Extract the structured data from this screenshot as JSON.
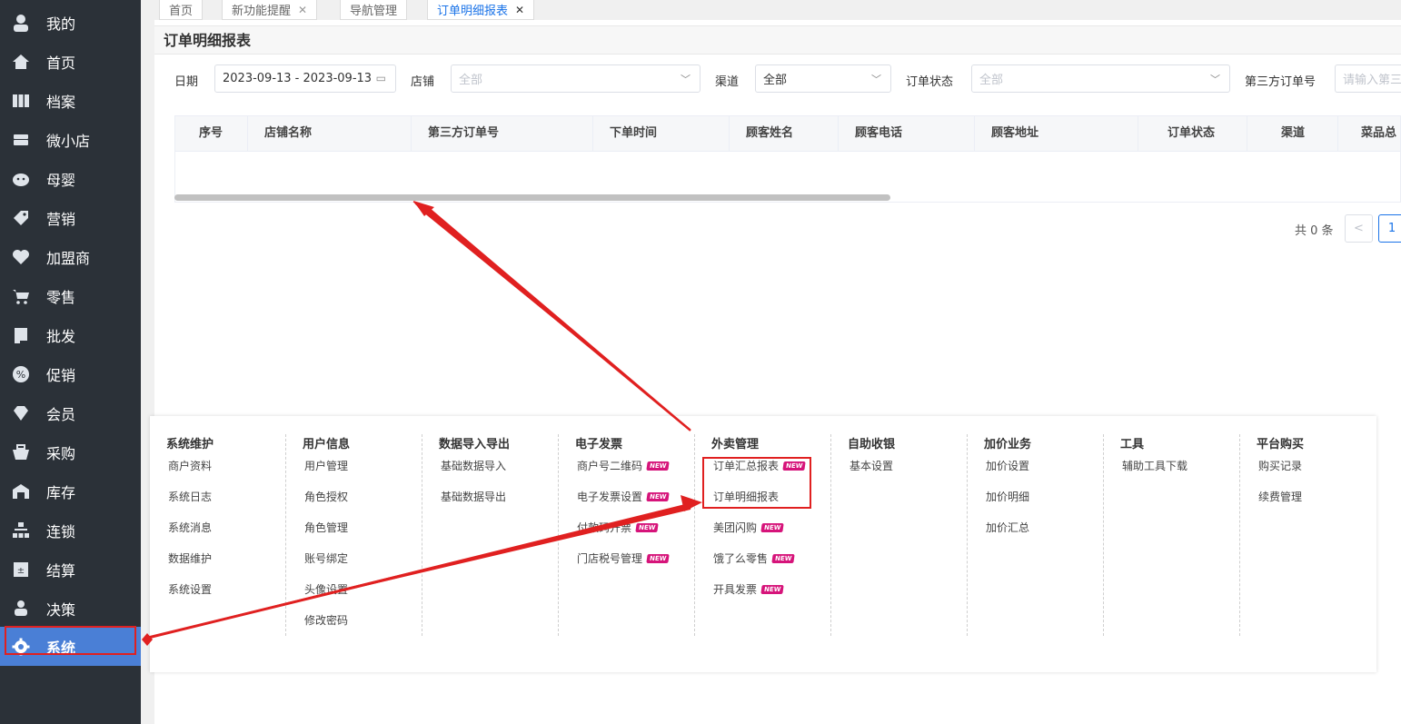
{
  "sidebar": {
    "items": [
      {
        "label": "我的",
        "icon": "user-icon"
      },
      {
        "label": "首页",
        "icon": "home-icon"
      },
      {
        "label": "档案",
        "icon": "grid-icon"
      },
      {
        "label": "微小店",
        "icon": "store-icon"
      },
      {
        "label": "母婴",
        "icon": "baby-icon"
      },
      {
        "label": "营销",
        "icon": "tag-icon"
      },
      {
        "label": "加盟商",
        "icon": "handshake-icon"
      },
      {
        "label": "零售",
        "icon": "cart-icon"
      },
      {
        "label": "批发",
        "icon": "book-icon"
      },
      {
        "label": "促销",
        "icon": "percent-icon"
      },
      {
        "label": "会员",
        "icon": "diamond-icon"
      },
      {
        "label": "采购",
        "icon": "basket-icon"
      },
      {
        "label": "库存",
        "icon": "warehouse-icon"
      },
      {
        "label": "连锁",
        "icon": "sitemap-icon"
      },
      {
        "label": "结算",
        "icon": "calculator-icon"
      },
      {
        "label": "决策",
        "icon": "person-icon"
      },
      {
        "label": "系统",
        "icon": "gear-icon"
      }
    ]
  },
  "tabs": [
    {
      "label": "首页",
      "closable": false
    },
    {
      "label": "新功能提醒",
      "closable": true
    },
    {
      "label": "导航管理",
      "closable": false
    },
    {
      "label": "订单明细报表",
      "closable": true
    }
  ],
  "page": {
    "title": "订单明细报表"
  },
  "filters": {
    "date_label": "日期",
    "date_value": "2023-09-13 - 2023-09-13",
    "store_label": "店铺",
    "store_value": "全部",
    "channel_label": "渠道",
    "channel_value": "全部",
    "status_label": "订单状态",
    "status_value": "全部",
    "third_label": "第三方订单号",
    "third_placeholder": "请输入第三"
  },
  "table": {
    "columns": [
      "序号",
      "店铺名称",
      "第三方订单号",
      "下单时间",
      "顾客姓名",
      "顾客电话",
      "顾客地址",
      "订单状态",
      "渠道",
      "菜品总"
    ]
  },
  "pager": {
    "total": "共 0 条",
    "prev": "<",
    "current": "1"
  },
  "menu": {
    "columns": [
      {
        "title": "系统维护",
        "items": [
          {
            "label": "商户资料"
          },
          {
            "label": "系统日志"
          },
          {
            "label": "系统消息"
          },
          {
            "label": "数据维护"
          },
          {
            "label": "系统设置"
          }
        ]
      },
      {
        "title": "用户信息",
        "items": [
          {
            "label": "用户管理"
          },
          {
            "label": "角色授权"
          },
          {
            "label": "角色管理"
          },
          {
            "label": "账号绑定"
          },
          {
            "label": "头像设置"
          },
          {
            "label": "修改密码"
          }
        ]
      },
      {
        "title": "数据导入导出",
        "items": [
          {
            "label": "基础数据导入"
          },
          {
            "label": "基础数据导出"
          }
        ]
      },
      {
        "title": "电子发票",
        "items": [
          {
            "label": "商户号二维码",
            "new": true
          },
          {
            "label": "电子发票设置",
            "new": true
          },
          {
            "label": "付款码开票",
            "new": true
          },
          {
            "label": "门店税号管理",
            "new": true
          }
        ]
      },
      {
        "title": "外卖管理",
        "items": [
          {
            "label": "订单汇总报表",
            "new": true
          },
          {
            "label": "订单明细报表"
          },
          {
            "label": "美团闪购",
            "new": true
          },
          {
            "label": "饿了么零售",
            "new": true
          },
          {
            "label": "开具发票",
            "new": true
          }
        ]
      },
      {
        "title": "自助收银",
        "items": [
          {
            "label": "基本设置"
          }
        ]
      },
      {
        "title": "加价业务",
        "items": [
          {
            "label": "加价设置"
          },
          {
            "label": "加价明细"
          },
          {
            "label": "加价汇总"
          }
        ]
      },
      {
        "title": "工具",
        "items": [
          {
            "label": "辅助工具下载"
          }
        ]
      },
      {
        "title": "平台购买",
        "items": [
          {
            "label": "购买记录"
          },
          {
            "label": "续费管理"
          }
        ]
      }
    ],
    "new_badge": "NEW"
  },
  "colors": {
    "sidebar_bg": "#2b3138",
    "active": "#4a7fd6",
    "annotation": "#e02020",
    "badge": "#d6147a"
  }
}
